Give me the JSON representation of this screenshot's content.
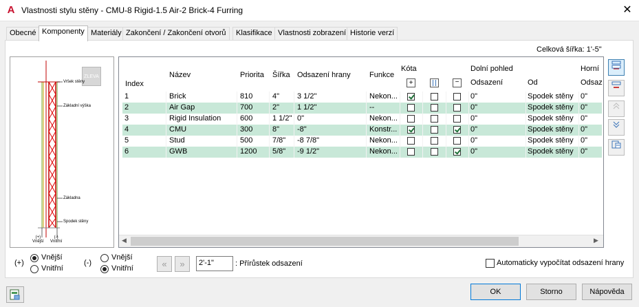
{
  "window": {
    "title": "Vlastnosti stylu stěny - CMU-8 Rigid-1.5 Air-2 Brick-4 Furring",
    "app_icon_letter": "A",
    "close_glyph": "✕"
  },
  "tabs": [
    {
      "label": "Obecné",
      "active": false
    },
    {
      "label": "Komponenty",
      "active": true
    },
    {
      "label": "Materiály",
      "active": false
    },
    {
      "label": "Zakončení / Zakončení otvorů",
      "active": false
    },
    {
      "label": "Klasifikace",
      "active": false
    },
    {
      "label": "Vlastnosti zobrazení",
      "active": false
    },
    {
      "label": "Historie verzí",
      "active": false
    }
  ],
  "total_width": "Celková šířka: 1'-5\"",
  "preview": {
    "view_badge": "ZLEVA",
    "labels": {
      "top": "Vršek stěny",
      "base_height": "Základní výška",
      "baseline": "Základna",
      "bottom": "Spodek stěny"
    },
    "side_labels": {
      "exterior_sign": "(+)",
      "exterior": "Vnější",
      "interior_sign": "(-)",
      "interior": "Vnitřní"
    }
  },
  "grid": {
    "headers": {
      "index": "Index",
      "name": "Název",
      "priority": "Priorita",
      "width": "Šířka",
      "edge_offset": "Odsazení hrany",
      "function": "Funkce",
      "dimension": "Kóta",
      "bottom_view": "Dolní pohled",
      "bottom_offset": "Odsazení",
      "bottom_from": "Od",
      "top_view": "Horní",
      "top_offset": "Odsaz"
    },
    "rows": [
      {
        "index": "1",
        "name": "Brick",
        "priority": "810",
        "width": "4\"",
        "edge": "3 1/2\"",
        "function": "Nekon...",
        "dim1": true,
        "dim2": false,
        "dim3": false,
        "offset": "0\"",
        "from": "Spodek stěny",
        "top_offset": "0\""
      },
      {
        "index": "2",
        "name": "Air Gap",
        "priority": "700",
        "width": "2\"",
        "edge": "1 1/2\"",
        "function": "--",
        "dim1": false,
        "dim2": false,
        "dim3": false,
        "offset": "0\"",
        "from": "Spodek stěny",
        "top_offset": "0\""
      },
      {
        "index": "3",
        "name": "Rigid Insulation",
        "priority": "600",
        "width": "1 1/2\"",
        "edge": "0\"",
        "function": "Nekon...",
        "dim1": false,
        "dim2": false,
        "dim3": false,
        "offset": "0\"",
        "from": "Spodek stěny",
        "top_offset": "0\""
      },
      {
        "index": "4",
        "name": "CMU",
        "priority": "300",
        "width": "8\"",
        "edge": "-8\"",
        "function": "Konstr...",
        "dim1": true,
        "dim2": false,
        "dim3": true,
        "offset": "0\"",
        "from": "Spodek stěny",
        "top_offset": "0\""
      },
      {
        "index": "5",
        "name": "Stud",
        "priority": "500",
        "width": "7/8\"",
        "edge": "-8 7/8\"",
        "function": "Nekon...",
        "dim1": false,
        "dim2": false,
        "dim3": false,
        "offset": "0\"",
        "from": "Spodek stěny",
        "top_offset": "0\""
      },
      {
        "index": "6",
        "name": "GWB",
        "priority": "1200",
        "width": "5/8\"",
        "edge": "-9 1/2\"",
        "function": "Nekon...",
        "dim1": false,
        "dim2": false,
        "dim3": true,
        "offset": "0\"",
        "from": "Spodek stěny",
        "top_offset": "0\""
      }
    ]
  },
  "bottom": {
    "plus_sign": "(+)",
    "minus_sign": "(-)",
    "left_group": {
      "exterior": "Vnější",
      "interior": "Vnitřní",
      "selected": "exterior"
    },
    "right_group": {
      "exterior": "Vnější",
      "interior": "Vnitřní",
      "selected": "interior"
    },
    "increment_value": "2'-1\"",
    "increment_label": ": Přírůstek odsazení",
    "auto_checkbox_label": "Automaticky vypočítat odsazení hrany",
    "auto_checkbox_checked": false
  },
  "buttons": {
    "ok": "OK",
    "cancel": "Storno",
    "help": "Nápověda"
  }
}
